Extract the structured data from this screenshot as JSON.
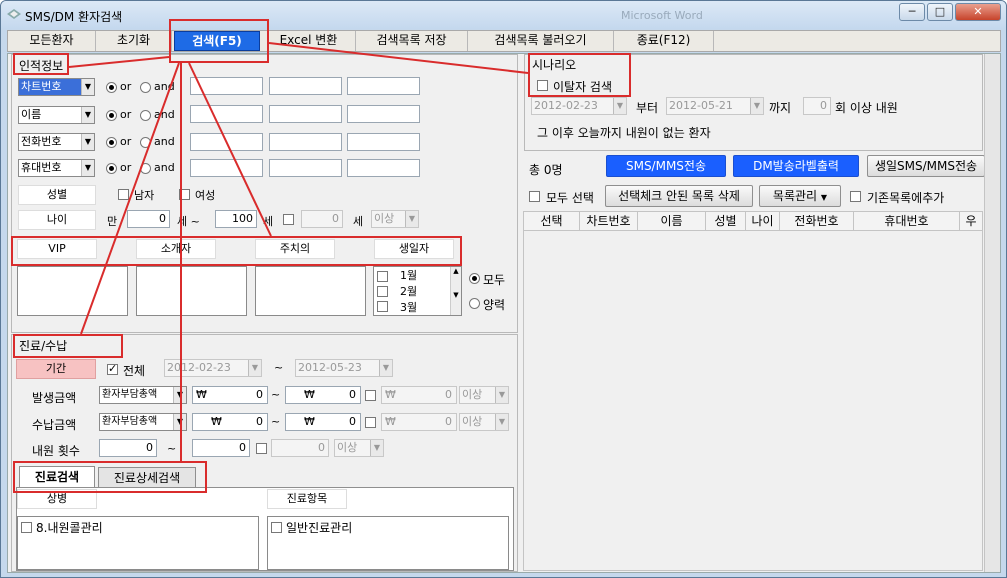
{
  "window": {
    "title": "SMS/DM 환자검색",
    "blur_text": "Microsoft Word"
  },
  "menu": {
    "items": [
      "모든환자",
      "초기화",
      "검색(F5)",
      "Excel 변환",
      "검색목록 저장",
      "검색목록 불러오기",
      "종료(F12)"
    ]
  },
  "personal": {
    "title": "인적정보",
    "rows": [
      {
        "field": "차트번호",
        "or": "or",
        "and": "and"
      },
      {
        "field": "이름",
        "or": "or",
        "and": "and"
      },
      {
        "field": "전화번호",
        "or": "or",
        "and": "and"
      },
      {
        "field": "휴대번호",
        "or": "or",
        "and": "and"
      }
    ],
    "gender_label": "성별",
    "male": "남자",
    "female": "여성",
    "age_label": "나이",
    "age_man": "만",
    "age_from": "0",
    "age_se1": "세 ~",
    "age_to": "100",
    "age_se2": "세",
    "age_extra": "0",
    "age_se3": "세",
    "age_over": "이상",
    "categories": [
      "VIP",
      "소개자",
      "주치의",
      "생일자"
    ],
    "months": [
      "1월",
      "2월",
      "3월"
    ],
    "all": "모두",
    "lunar": "양력"
  },
  "treatment": {
    "title": "진료/수납",
    "period_label": "기간",
    "all": "전체",
    "date_from": "2012-02-23",
    "date_to": "2012-05-23",
    "tilde": "~",
    "issue_label": "발생금액",
    "issue_select": "환자부담총액",
    "pay_label": "수납금액",
    "pay_select": "환자부담총액",
    "won": "₩",
    "zero": "0",
    "over": "이상",
    "visit_label": "내원 횟수",
    "visit_from": "0",
    "visit_to": "0",
    "visit_extra": "0"
  },
  "tabs": [
    "진료검색",
    "진료상세검색"
  ],
  "lower": {
    "col1": "상병",
    "col2": "진료항목",
    "item1": "8.내원콜관리",
    "item2": "일반진료관리"
  },
  "scenario": {
    "title": "시나리오",
    "dropout": "이탈자 검색",
    "date_from": "2012-02-23",
    "from_label": "부터",
    "date_to": "2012-05-21",
    "to_label": "까지",
    "count": "0",
    "count_label": "회 이상 내원",
    "desc": "그 이후 오늘까지 내원이 없는 환자"
  },
  "results": {
    "total": "총 0명",
    "sms_btn": "SMS/MMS전송",
    "dm_btn": "DM발송라벨출력",
    "bday_btn": "생일SMS/MMS전송",
    "select_all": "모두 선택",
    "delete_btn": "선택체크 안된 목록 삭제",
    "manage_btn": "목록관리",
    "add_existing": "기존목록에추가",
    "columns": [
      "선택",
      "차트번호",
      "이름",
      "성별",
      "나이",
      "전화번호",
      "휴대번호",
      "우"
    ]
  },
  "colors": {
    "accent": "#1e6be6",
    "annot": "#d92c2c",
    "sms_btn": "#1a5fff"
  }
}
